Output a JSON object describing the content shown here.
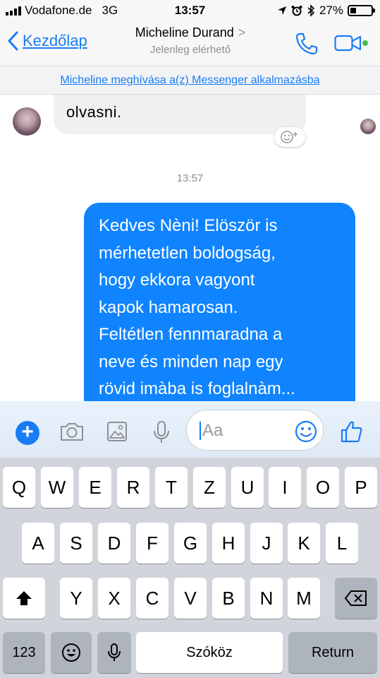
{
  "status_bar": {
    "carrier": "Vodafone.de",
    "network": "3G",
    "time": "13:57",
    "battery_percent": "27%",
    "battery_level": 0.27
  },
  "nav": {
    "back_label": "Kezdőlap",
    "contact_name": "Micheline Durand",
    "contact_chevron": ">",
    "contact_status": "Jelenleg elérhető",
    "accent_color": "#1a7cf5",
    "online_color": "#44c04d"
  },
  "invite_banner": {
    "text": "Micheline meghívása a(z) Messenger alkalmazásba"
  },
  "chat": {
    "incoming_message": "olvasni.",
    "timestamp": "13:57",
    "outgoing_lines": [
      "Kedves Nèni! Elöször is",
      "mérhetetlen boldogság,",
      "hogy ekkora vagyont",
      "kapok hamarosan.",
      "Feltétlen fennmaradna a",
      "neve és minden nap egy",
      "rövid imàba is foglalnàm..."
    ],
    "outgoing_color": "#1084ff"
  },
  "composer": {
    "plus_label": "+",
    "placeholder": "Aa"
  },
  "keyboard": {
    "row1": [
      "Q",
      "W",
      "E",
      "R",
      "T",
      "Z",
      "U",
      "I",
      "O",
      "P"
    ],
    "row2": [
      "A",
      "S",
      "D",
      "F",
      "G",
      "H",
      "J",
      "K",
      "L"
    ],
    "row3": [
      "Y",
      "X",
      "C",
      "V",
      "B",
      "N",
      "M"
    ],
    "numbers_label": "123",
    "space_label": "Szóköz",
    "return_label": "Return"
  }
}
